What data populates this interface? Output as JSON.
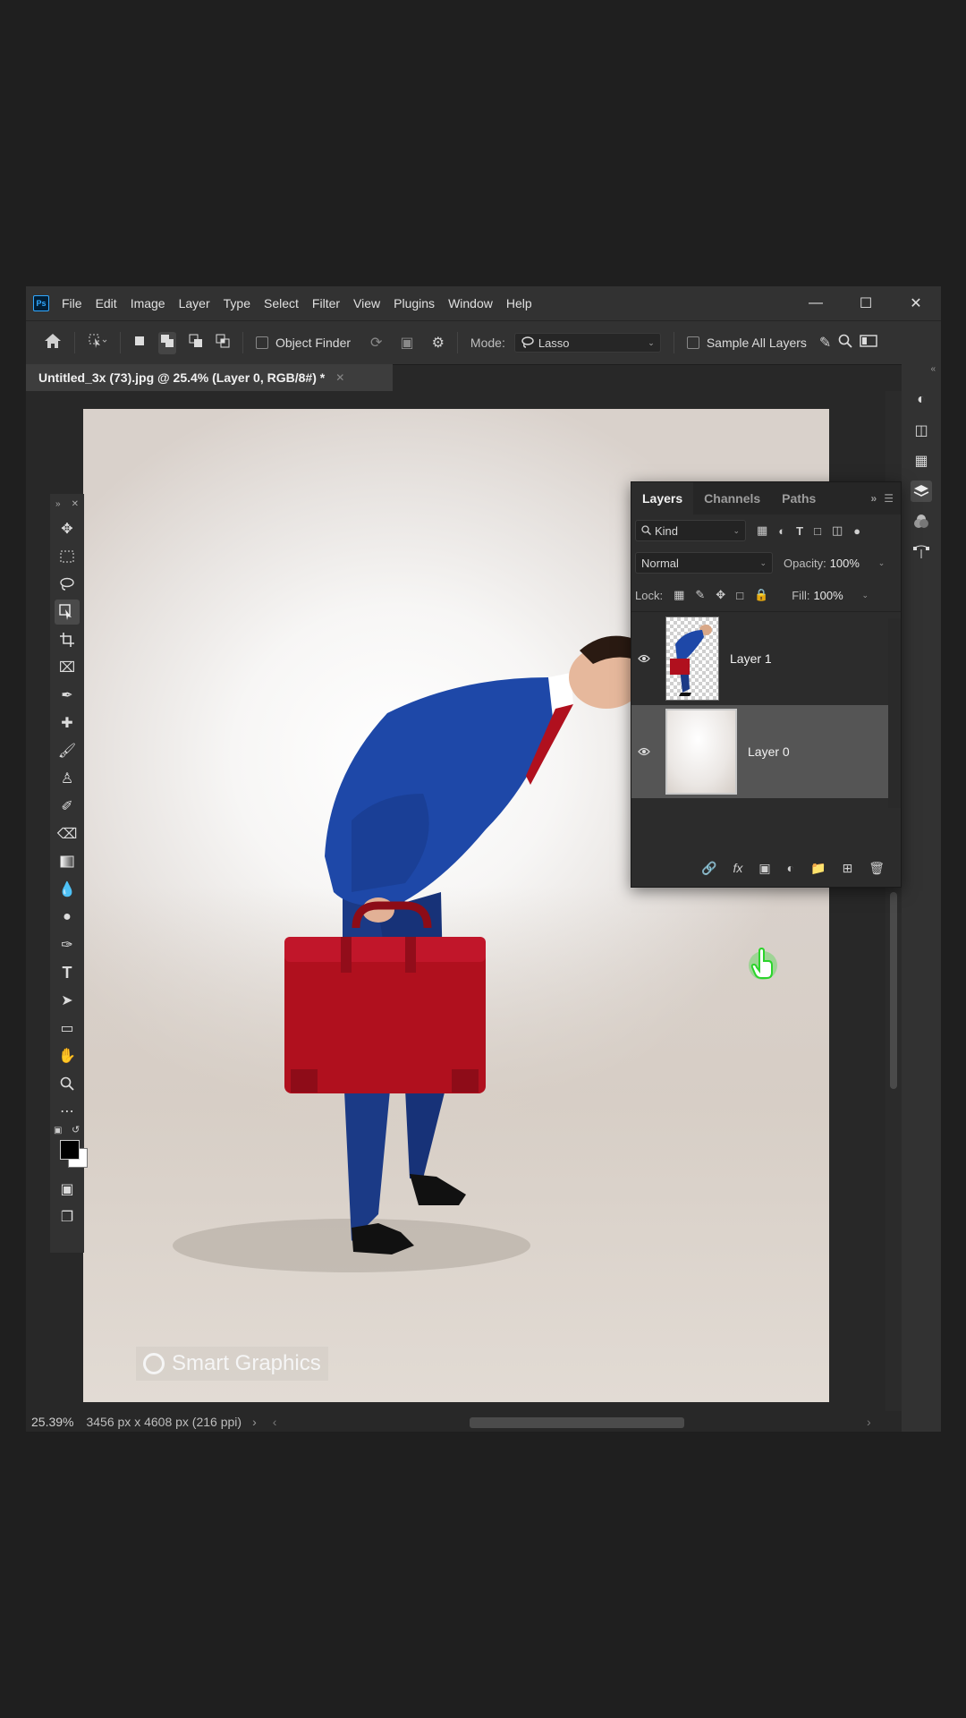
{
  "menubar": {
    "items": [
      "File",
      "Edit",
      "Image",
      "Layer",
      "Type",
      "Select",
      "Filter",
      "View",
      "Plugins",
      "Window",
      "Help"
    ]
  },
  "options": {
    "object_finder": "Object Finder",
    "mode_label": "Mode:",
    "mode_value": "Lasso",
    "sample_all_layers": "Sample All Layers"
  },
  "document": {
    "tab_title": "Untitled_3x (73).jpg @ 25.4% (Layer 0, RGB/8#) *"
  },
  "status": {
    "zoom": "25.39%",
    "dimensions": "3456 px x 4608 px (216 ppi)"
  },
  "layers_panel": {
    "tabs": [
      "Layers",
      "Channels",
      "Paths"
    ],
    "filter_kind": "Kind",
    "blend_mode": "Normal",
    "opacity_label": "Opacity:",
    "opacity_value": "100%",
    "lock_label": "Lock:",
    "fill_label": "Fill:",
    "fill_value": "100%",
    "layers": [
      {
        "name": "Layer 1",
        "visible": true,
        "selected": false
      },
      {
        "name": "Layer 0",
        "visible": true,
        "selected": true
      }
    ]
  },
  "watermark": {
    "text": "Smart Graphics"
  },
  "colors": {
    "suit": "#1e3f8f",
    "briefcase": "#b0101e",
    "highlight_green": "#33dd33"
  }
}
